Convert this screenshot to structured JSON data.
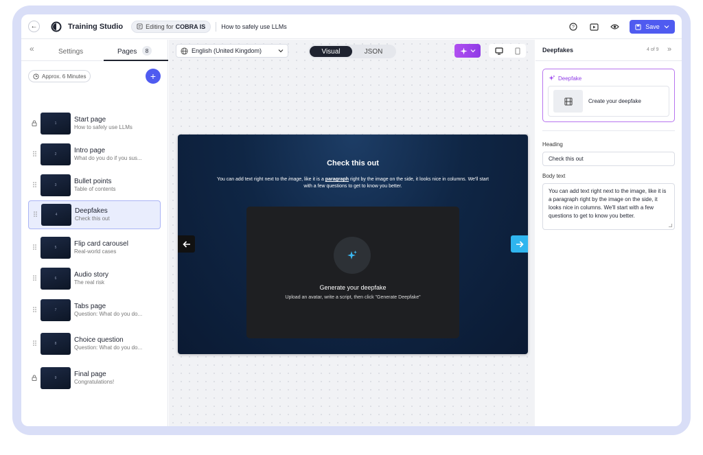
{
  "topbar": {
    "back_label": "←",
    "app_title": "Training Studio",
    "editing_prefix": "Editing for",
    "editing_org": "COBRA IS",
    "doc_title": "How to safely use LLMs",
    "save_label": "Save"
  },
  "sidebar": {
    "collapse_icon": "«",
    "tab_settings": "Settings",
    "tab_pages": "Pages",
    "page_count": "8",
    "duration": "Approx. 6 Minutes",
    "add_label": "+",
    "pages": [
      {
        "title": "Start page",
        "subtitle": "How to safely use LLMs",
        "thumb": "1",
        "locked": true
      },
      {
        "title": "Intro page",
        "subtitle": "What do you do if you sus...",
        "thumb": "2",
        "locked": false
      },
      {
        "title": "Bullet points",
        "subtitle": "Table of contents",
        "thumb": "3",
        "locked": false
      },
      {
        "title": "Deepfakes",
        "subtitle": "Check this out",
        "thumb": "4",
        "locked": false,
        "active": true
      },
      {
        "title": "Flip card carousel",
        "subtitle": "Real-world cases",
        "thumb": "5",
        "locked": false
      },
      {
        "title": "Audio story",
        "subtitle": "The real risk",
        "thumb": "6",
        "locked": false
      },
      {
        "title": "Tabs page",
        "subtitle": "Question: What do you do...",
        "thumb": "7",
        "locked": false
      },
      {
        "title": "Choice question",
        "subtitle": "Question: What do you do...",
        "thumb": "8",
        "locked": false
      },
      {
        "title": "Final page",
        "subtitle": "Congratulations!",
        "thumb": "9",
        "locked": true
      }
    ]
  },
  "editor": {
    "language": "English (United Kingdom)",
    "view_visual": "Visual",
    "view_json": "JSON",
    "slide": {
      "heading": "Check this out",
      "body_pre": "You can add text right next to the ",
      "body_em": "image",
      "body_mid": ", like it is a ",
      "body_u": "paragraph",
      "body_post": " right by the image on the side, it looks nice in columns. We'll start with a few questions to get to know you better.",
      "deepfake_title": "Generate your deepfake",
      "deepfake_sub": "Upload an avatar, write a script, then click \"Generate Deepfake\""
    }
  },
  "panel": {
    "title": "Deepfakes",
    "position": "4 of 9",
    "next_icon": "»",
    "card_label": "Deepfake",
    "card_action": "Create your deepfake",
    "heading_label": "Heading",
    "heading_value": "Check this out",
    "body_label": "Body text",
    "body_value": "You can add text right next to the image, like it is a paragraph right by the image on the side, it looks nice in columns. We'll start with a few questions to get to know you better."
  },
  "colors": {
    "accent": "#4f5bf0",
    "ai_purple": "#9b45ee",
    "slide_arrow": "#2fb5ef",
    "slide_bg": "#0f2645"
  },
  "icons": [
    "back-icon",
    "logo-icon",
    "edit-icon",
    "help-icon",
    "play-icon",
    "preview-eye-icon",
    "save-disk-icon",
    "chevron-down-icon",
    "clock-icon",
    "lock-icon",
    "drag-handle-icon",
    "globe-icon",
    "sparkle-icon",
    "desktop-icon",
    "mobile-icon",
    "arrow-left-icon",
    "arrow-right-icon",
    "film-icon"
  ]
}
